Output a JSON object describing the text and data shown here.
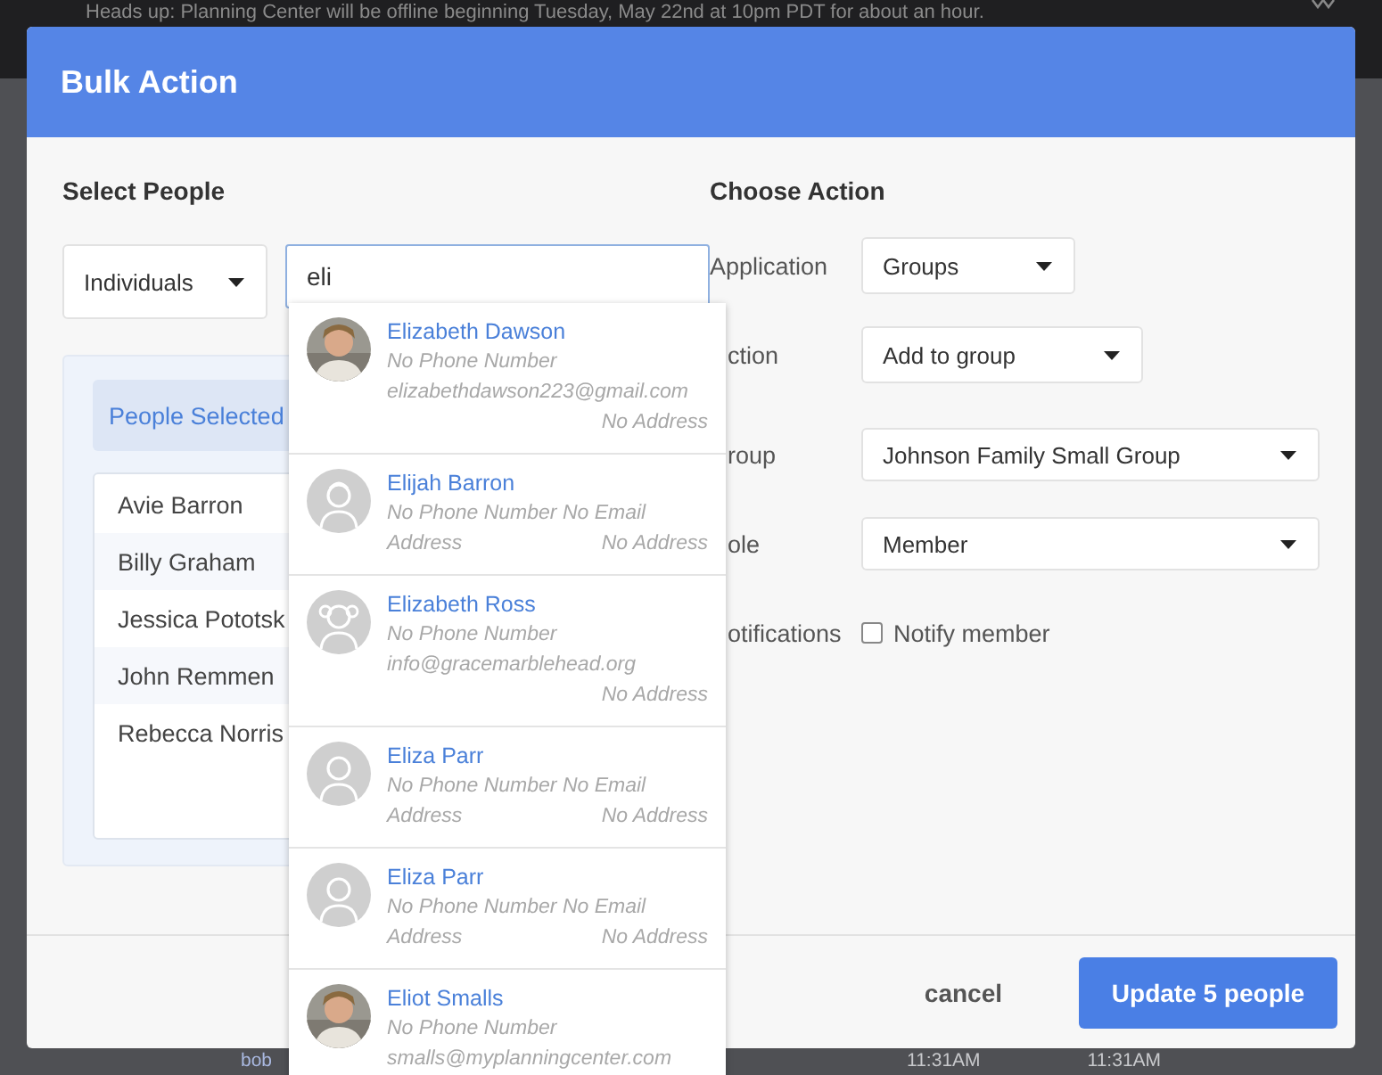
{
  "banner": {
    "text": "Heads up: Planning Center will be offline beginning Tuesday, May 22nd at 10pm PDT for about an hour."
  },
  "modal": {
    "title": "Bulk Action",
    "left_heading": "Select People",
    "right_heading": "Choose Action"
  },
  "mode_select": {
    "value": "Individuals"
  },
  "search": {
    "value": "eli"
  },
  "people_selected": {
    "title": "People Selected",
    "people": [
      "Avie Barron",
      "Billy Graham",
      "Jessica Pototsk",
      "John Remmen",
      "Rebecca Norris"
    ]
  },
  "results": [
    {
      "name": "Elizabeth Dawson",
      "rows": [
        {
          "left": "No Phone Number"
        },
        {
          "left": "elizabethdawson223@gmail.com"
        },
        {
          "right": "No Address"
        }
      ]
    },
    {
      "name": "Elijah Barron",
      "kind": "boy",
      "rows": [
        {
          "left": "No Phone Number No Email"
        },
        {
          "left": "Address",
          "right": "No Address"
        }
      ]
    },
    {
      "name": "Elizabeth Ross",
      "kind": "girl",
      "rows": [
        {
          "left": "No Phone Number"
        },
        {
          "left": "info@gracemarblehead.org"
        },
        {
          "right": "No Address"
        }
      ]
    },
    {
      "name": "Eliza Parr",
      "kind": "generic",
      "rows": [
        {
          "left": "No Phone Number No Email"
        },
        {
          "left": "Address",
          "right": "No Address"
        }
      ]
    },
    {
      "name": "Eliza Parr",
      "kind": "generic",
      "rows": [
        {
          "left": "No Phone Number No Email"
        },
        {
          "left": "Address",
          "right": "No Address"
        }
      ]
    },
    {
      "name": "Eliot Smalls",
      "rows": [
        {
          "left": "No Phone Number"
        },
        {
          "left": "smalls@myplanningcenter.com"
        }
      ]
    }
  ],
  "action_rows": [
    {
      "label": "Application",
      "kind": "select",
      "value": "Groups"
    },
    {
      "label": "ction",
      "kind": "select",
      "value": "Add to group"
    },
    {
      "label": "roup",
      "kind": "select",
      "value": "Johnson Family Small Group"
    },
    {
      "label": "ole",
      "kind": "select",
      "value": "Member"
    },
    {
      "label": "otifications",
      "kind": "checkbox",
      "option": "Notify member",
      "checked": false
    }
  ],
  "footer": {
    "cancel": "cancel",
    "submit": "Update 5 people"
  },
  "background_row": {
    "name": "bob",
    "times": [
      "11:31AM",
      "11:31AM"
    ]
  }
}
